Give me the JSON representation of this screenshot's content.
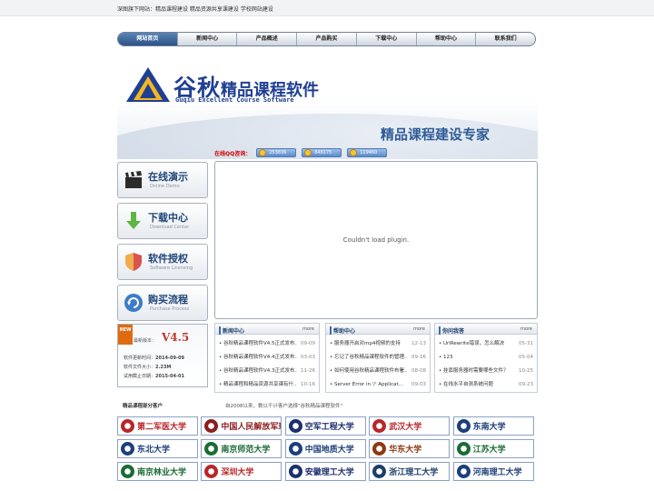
{
  "topbar": {
    "links": "深图旗下网站：精品课程建设  精品资源共享课建设  学校网站建设"
  },
  "nav": {
    "items": [
      "网站首页",
      "新闻中心",
      "产品概述",
      "产品购买",
      "下载中心",
      "帮助中心",
      "联系我们"
    ],
    "active_index": 0
  },
  "brand": {
    "logo_big": "谷秋",
    "logo_rest": "精品课程软件",
    "logo_en": "Guqiu Excellent Course Software",
    "slogan": "精品课程建设专家"
  },
  "qq": {
    "label": "在线QQ咨询：",
    "numbers": [
      "253836",
      "848175",
      "119460"
    ]
  },
  "side_buttons": [
    {
      "title": "在线演示",
      "subtitle": "Online Demo",
      "icon": "clapperboard-icon"
    },
    {
      "title": "下载中心",
      "subtitle": "Download Center",
      "icon": "download-arrow-icon"
    },
    {
      "title": "软件授权",
      "subtitle": "Software Licensing",
      "icon": "shield-icon"
    },
    {
      "title": "购买流程",
      "subtitle": "Purchase Process",
      "icon": "refresh-icon"
    }
  ],
  "version_box": {
    "tag": "NEW",
    "latest_label": "最新版本：",
    "version": "V4.5",
    "rows": [
      {
        "label": "软件更新时间：",
        "value": "2014-09-09"
      },
      {
        "label": "软件文件大小：",
        "value": "2.23M"
      },
      {
        "label": "试用截止日期：",
        "value": "2015-04-01"
      }
    ]
  },
  "plugin": {
    "message": "Couldn't load plugin."
  },
  "panels": {
    "news": {
      "title": "新闻中心",
      "more": "more",
      "items": [
        {
          "text": "谷秋精品课程软件V4.5正式发布...",
          "date": "09-09"
        },
        {
          "text": "谷秋精品课程软件V4.4正式发布...",
          "date": "03-03"
        },
        {
          "text": "谷秋精品课程软件V4.3正式发布...",
          "date": "11-26"
        },
        {
          "text": "精品课程和精品资源共享课有什...",
          "date": "10-16"
        }
      ]
    },
    "help": {
      "title": "帮助中心",
      "more": "more",
      "items": [
        {
          "text": "服务器开启对mp4视频的支持",
          "date": "12-13"
        },
        {
          "text": "忘记了谷秋精品课程软件的管理...",
          "date": "09-16"
        },
        {
          "text": "如何使用谷秋精品课程软件布署...",
          "date": "08-08"
        },
        {
          "text": "Server Error in '/' Applicat...",
          "date": "09-03"
        }
      ]
    },
    "faq": {
      "title": "你问我答",
      "more": "more",
      "items": [
        {
          "text": "UrlRewrite错误，怎么解决",
          "date": "05-31"
        },
        {
          "text": "123",
          "date": "05-04"
        },
        {
          "text": "挂靠服务器时需要哪些文件？",
          "date": "10-25"
        },
        {
          "text": "在线水平自测系统问题",
          "date": "09-23"
        }
      ]
    }
  },
  "partners": {
    "title": "精品课程部分客户",
    "desc": "自2008以来，数以千计客户选择\"谷秋精品课程软件\"",
    "logos": [
      {
        "name": "第二军医大学",
        "color": "#b8262a"
      },
      {
        "name": "中国人民解放军理工大学",
        "color": "#8b1e1e"
      },
      {
        "name": "空军工程大学",
        "color": "#1d2f6e"
      },
      {
        "name": "武汉大学",
        "color": "#b8262a"
      },
      {
        "name": "东南大学",
        "color": "#1d3f7a"
      },
      {
        "name": "东北大学",
        "color": "#1d3f7a"
      },
      {
        "name": "南京师范大学",
        "color": "#1b6b34"
      },
      {
        "name": "中国地质大学",
        "color": "#1d3f7a"
      },
      {
        "name": "华东大学",
        "color": "#8b3a12"
      },
      {
        "name": "江苏大学",
        "color": "#1b6b34"
      },
      {
        "name": "南京林业大学",
        "color": "#1b6b34"
      },
      {
        "name": "深圳大学",
        "color": "#b8262a"
      },
      {
        "name": "安徽理工大学",
        "color": "#1d2f6e"
      },
      {
        "name": "浙江理工大学",
        "color": "#1b3f68"
      },
      {
        "name": "河南理工大学",
        "color": "#1d3f7a"
      }
    ]
  }
}
